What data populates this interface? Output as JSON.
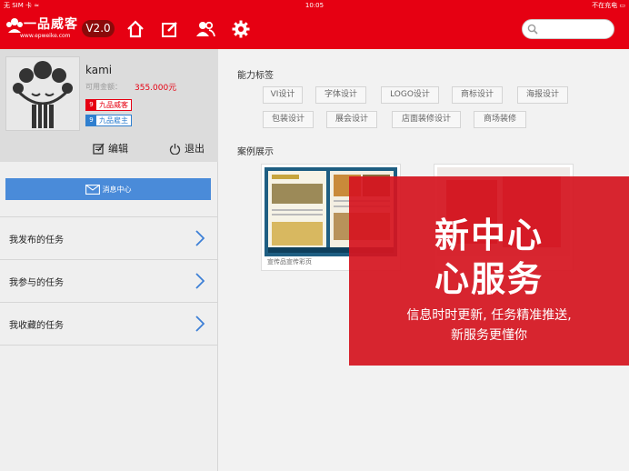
{
  "status_bar": {
    "carrier": "无 SIM 卡 ≈",
    "time": "10:05",
    "battery": "不在充电 ▭"
  },
  "header": {
    "logo_text": "一品威客",
    "logo_url": "www.epweike.com",
    "version": "V2.0",
    "nav_icons": [
      "home-icon",
      "edit-icon",
      "users-icon",
      "settings-icon"
    ],
    "search": {
      "placeholder": ""
    },
    "accent": "#e60012"
  },
  "profile": {
    "username": "kami",
    "balance_label": "可用金额：",
    "balance_value": "355.000元",
    "badges": [
      {
        "num": "9",
        "label": "九品威客"
      },
      {
        "num": "9",
        "label": "九品雇主"
      }
    ],
    "edit_label": "编辑",
    "logout_label": "退出"
  },
  "sidebar": {
    "message_center": "消息中心",
    "menu": [
      {
        "label": "我发布的任务"
      },
      {
        "label": "我参与的任务"
      },
      {
        "label": "我收藏的任务"
      }
    ]
  },
  "main": {
    "skills_title": "能力标签",
    "tags": [
      "VI设计",
      "字体设计",
      "LOGO设计",
      "商标设计",
      "海报设计",
      "包装设计",
      "展会设计",
      "店面装修设计",
      "商场装修"
    ],
    "cases_title": "案例展示",
    "cases": [
      {
        "caption": "宣传品宣传彩页"
      },
      {
        "caption": ""
      }
    ]
  },
  "promo": {
    "line1": "新中心",
    "line2": "心服务",
    "line3": "信息时时更新, 任务精准推送,",
    "line4": "新服务更懂你"
  }
}
